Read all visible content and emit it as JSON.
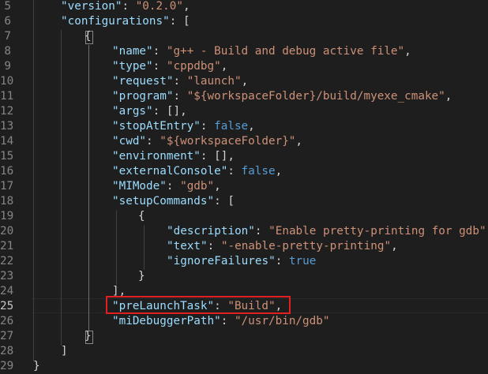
{
  "editor": {
    "lines": [
      {
        "num": "5",
        "tokens": [
          {
            "t": "key",
            "v": "\"version\""
          },
          {
            "t": "pun",
            "v": ": "
          },
          {
            "t": "str",
            "v": "\"0.2.0\""
          },
          {
            "t": "pun",
            "v": ","
          }
        ]
      },
      {
        "num": "6",
        "tokens": [
          {
            "t": "key",
            "v": "\"configurations\""
          },
          {
            "t": "pun",
            "v": ": ["
          }
        ]
      },
      {
        "num": "7",
        "tokens": [
          {
            "t": "pun",
            "v": "{"
          }
        ]
      },
      {
        "num": "8",
        "tokens": [
          {
            "t": "key",
            "v": "\"name\""
          },
          {
            "t": "pun",
            "v": ": "
          },
          {
            "t": "str",
            "v": "\"g++ - Build and debug active file\""
          },
          {
            "t": "pun",
            "v": ","
          }
        ]
      },
      {
        "num": "9",
        "tokens": [
          {
            "t": "key",
            "v": "\"type\""
          },
          {
            "t": "pun",
            "v": ": "
          },
          {
            "t": "str",
            "v": "\"cppdbg\""
          },
          {
            "t": "pun",
            "v": ","
          }
        ]
      },
      {
        "num": "10",
        "tokens": [
          {
            "t": "key",
            "v": "\"request\""
          },
          {
            "t": "pun",
            "v": ": "
          },
          {
            "t": "str",
            "v": "\"launch\""
          },
          {
            "t": "pun",
            "v": ","
          }
        ]
      },
      {
        "num": "11",
        "tokens": [
          {
            "t": "key",
            "v": "\"program\""
          },
          {
            "t": "pun",
            "v": ": "
          },
          {
            "t": "str",
            "v": "\"${workspaceFolder}/build/myexe_cmake\""
          },
          {
            "t": "pun",
            "v": ","
          }
        ]
      },
      {
        "num": "12",
        "tokens": [
          {
            "t": "key",
            "v": "\"args\""
          },
          {
            "t": "pun",
            "v": ": [],"
          }
        ]
      },
      {
        "num": "13",
        "tokens": [
          {
            "t": "key",
            "v": "\"stopAtEntry\""
          },
          {
            "t": "pun",
            "v": ": "
          },
          {
            "t": "kw",
            "v": "false"
          },
          {
            "t": "pun",
            "v": ","
          }
        ]
      },
      {
        "num": "14",
        "tokens": [
          {
            "t": "key",
            "v": "\"cwd\""
          },
          {
            "t": "pun",
            "v": ": "
          },
          {
            "t": "str",
            "v": "\"${workspaceFolder}\""
          },
          {
            "t": "pun",
            "v": ","
          }
        ]
      },
      {
        "num": "15",
        "tokens": [
          {
            "t": "key",
            "v": "\"environment\""
          },
          {
            "t": "pun",
            "v": ": [],"
          }
        ]
      },
      {
        "num": "16",
        "tokens": [
          {
            "t": "key",
            "v": "\"externalConsole\""
          },
          {
            "t": "pun",
            "v": ": "
          },
          {
            "t": "kw",
            "v": "false"
          },
          {
            "t": "pun",
            "v": ","
          }
        ]
      },
      {
        "num": "17",
        "tokens": [
          {
            "t": "key",
            "v": "\"MIMode\""
          },
          {
            "t": "pun",
            "v": ": "
          },
          {
            "t": "str",
            "v": "\"gdb\""
          },
          {
            "t": "pun",
            "v": ","
          }
        ]
      },
      {
        "num": "18",
        "tokens": [
          {
            "t": "key",
            "v": "\"setupCommands\""
          },
          {
            "t": "pun",
            "v": ": ["
          }
        ]
      },
      {
        "num": "19",
        "tokens": [
          {
            "t": "pun",
            "v": "{"
          }
        ]
      },
      {
        "num": "20",
        "tokens": [
          {
            "t": "key",
            "v": "\"description\""
          },
          {
            "t": "pun",
            "v": ": "
          },
          {
            "t": "str",
            "v": "\"Enable pretty-printing for gdb\""
          },
          {
            "t": "pun",
            "v": ","
          }
        ]
      },
      {
        "num": "21",
        "tokens": [
          {
            "t": "key",
            "v": "\"text\""
          },
          {
            "t": "pun",
            "v": ": "
          },
          {
            "t": "str",
            "v": "\"-enable-pretty-printing\""
          },
          {
            "t": "pun",
            "v": ","
          }
        ]
      },
      {
        "num": "22",
        "tokens": [
          {
            "t": "key",
            "v": "\"ignoreFailures\""
          },
          {
            "t": "pun",
            "v": ": "
          },
          {
            "t": "kw",
            "v": "true"
          }
        ]
      },
      {
        "num": "23",
        "tokens": [
          {
            "t": "pun",
            "v": "}"
          }
        ]
      },
      {
        "num": "24",
        "tokens": [
          {
            "t": "pun",
            "v": "],"
          }
        ]
      },
      {
        "num": "25",
        "tokens": [
          {
            "t": "key",
            "v": "\"preLaunchTask\""
          },
          {
            "t": "pun",
            "v": ": "
          },
          {
            "t": "str",
            "v": "\"Build\""
          },
          {
            "t": "pun",
            "v": ","
          }
        ]
      },
      {
        "num": "26",
        "tokens": [
          {
            "t": "key",
            "v": "\"miDebuggerPath\""
          },
          {
            "t": "pun",
            "v": ": "
          },
          {
            "t": "str",
            "v": "\"/usr/bin/gdb\""
          }
        ]
      },
      {
        "num": "27",
        "tokens": [
          {
            "t": "pun",
            "v": "}"
          }
        ]
      },
      {
        "num": "28",
        "tokens": [
          {
            "t": "pun",
            "v": "]"
          }
        ]
      },
      {
        "num": "29",
        "tokens": [
          {
            "t": "pun",
            "v": "}"
          }
        ]
      }
    ],
    "active_line": "25",
    "highlighted_line": "25"
  },
  "colors": {
    "background": "#1e1e1e",
    "key": "#9cdcfe",
    "string": "#ce9178",
    "keyword": "#569cd6",
    "punctuation": "#d4d4d4",
    "line_number": "#858585",
    "highlight_box": "#e02020"
  }
}
